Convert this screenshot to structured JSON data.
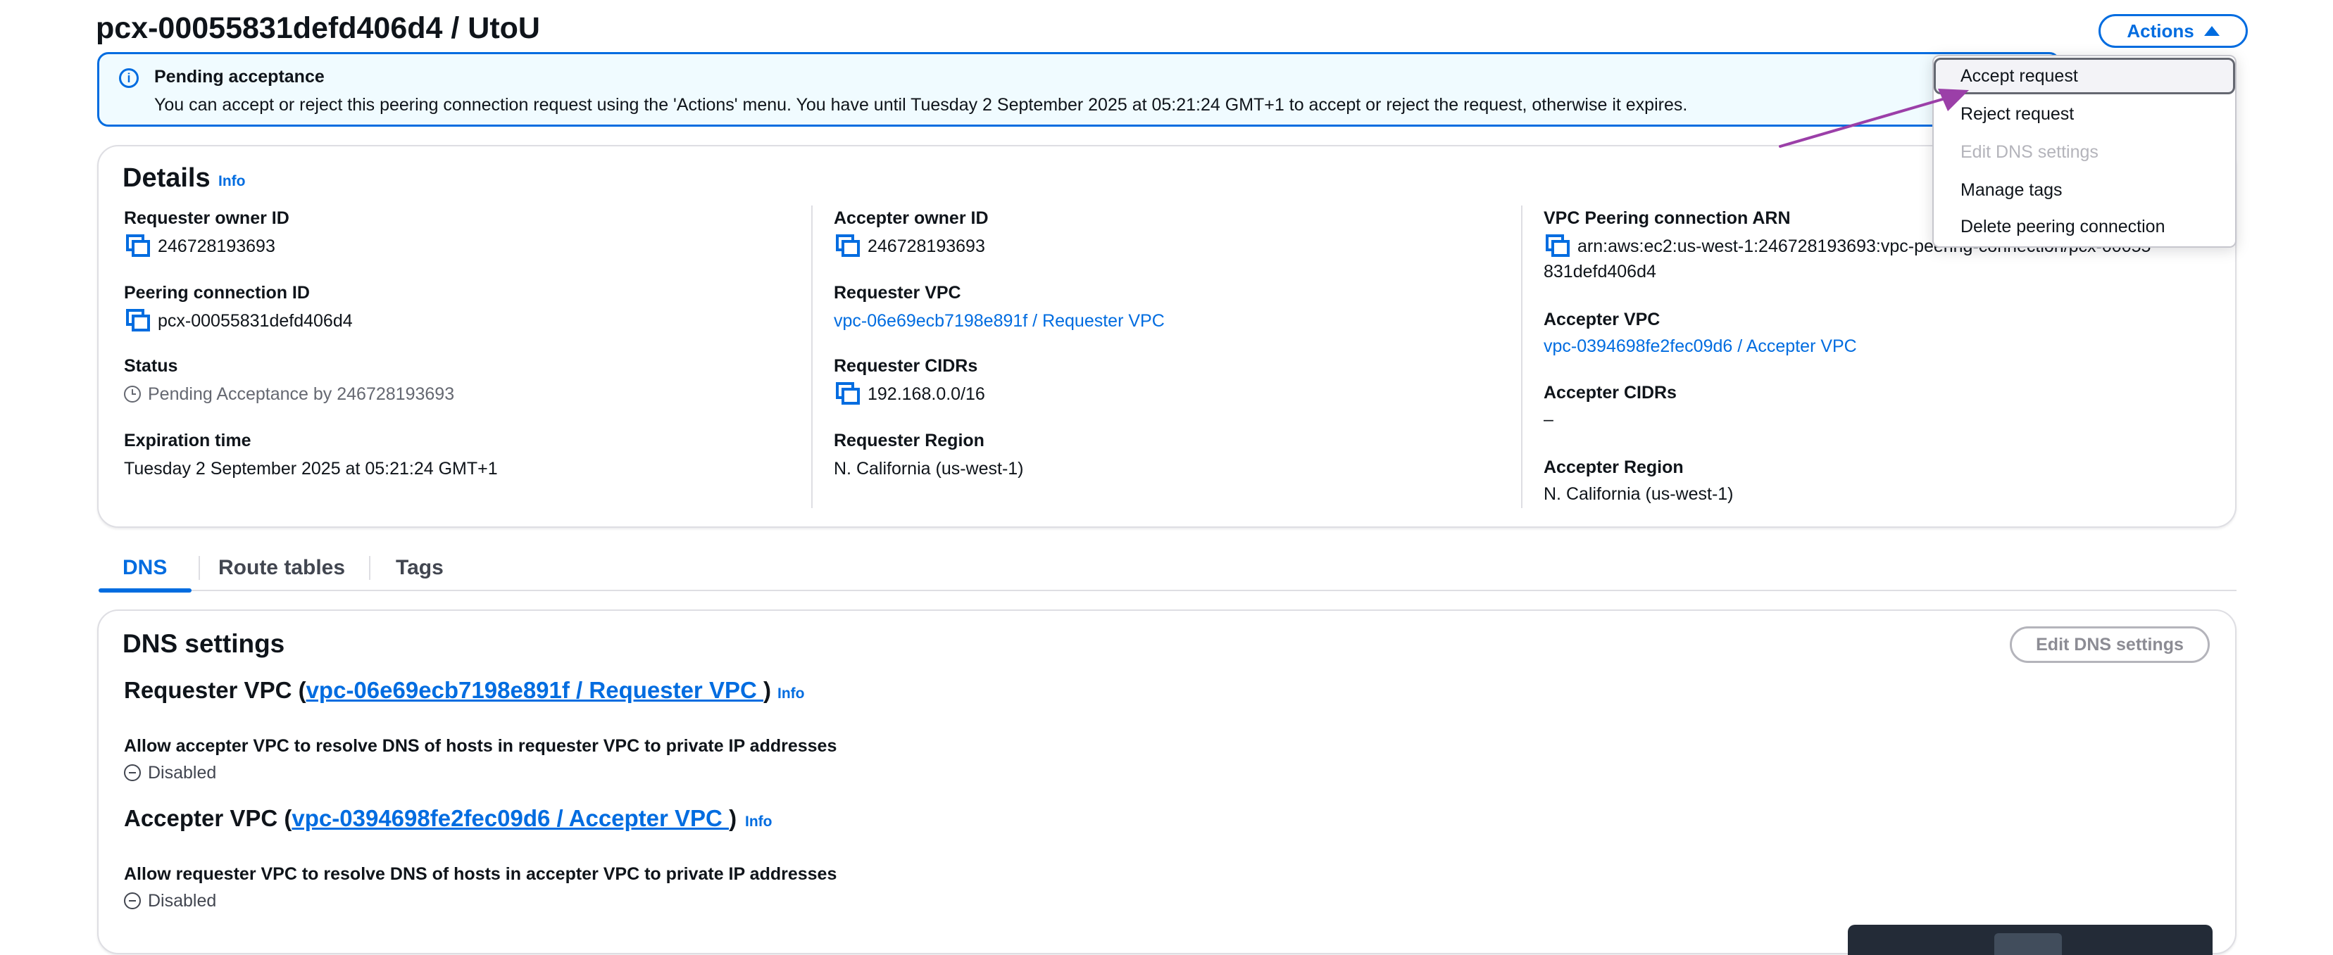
{
  "page": {
    "title": "pcx-00055831defd406d4 / UtoU",
    "actions_label": "Actions"
  },
  "alert": {
    "title": "Pending acceptance",
    "message": "You can accept or reject this peering connection request using the 'Actions' menu. You have until Tuesday 2 September 2025 at 05:21:24 GMT+1 to accept or reject the request, otherwise it expires."
  },
  "details": {
    "heading": "Details",
    "info": "Info",
    "col1": {
      "requester_owner_label": "Requester owner ID",
      "requester_owner_value": "246728193693",
      "peering_id_label": "Peering connection ID",
      "peering_id_value": "pcx-00055831defd406d4",
      "status_label": "Status",
      "status_value": "Pending Acceptance by 246728193693",
      "expiration_label": "Expiration time",
      "expiration_value": "Tuesday 2 September 2025 at 05:21:24 GMT+1"
    },
    "col2": {
      "accepter_owner_label": "Accepter owner ID",
      "accepter_owner_value": "246728193693",
      "requester_vpc_label": "Requester VPC",
      "requester_vpc_value": "vpc-06e69ecb7198e891f / Requester VPC",
      "requester_cidrs_label": "Requester CIDRs",
      "requester_cidrs_value": "192.168.0.0/16",
      "requester_region_label": "Requester Region",
      "requester_region_value": "N. California (us-west-1)"
    },
    "col3": {
      "arn_label": "VPC Peering connection ARN",
      "arn_line1": "arn:aws:ec2:us-west-1:246728193693:vpc-peering-connection/pcx-00055",
      "arn_line2": "831defd406d4",
      "accepter_vpc_label": "Accepter VPC",
      "accepter_vpc_value": "vpc-0394698fe2fec09d6 / Accepter VPC",
      "accepter_cidrs_label": "Accepter CIDRs",
      "accepter_cidrs_value": "–",
      "accepter_region_label": "Accepter Region",
      "accepter_region_value": "N. California (us-west-1)"
    }
  },
  "tabs": [
    {
      "label": "DNS"
    },
    {
      "label": "Route tables"
    },
    {
      "label": "Tags"
    }
  ],
  "dns": {
    "heading": "DNS settings",
    "edit_button": "Edit DNS settings",
    "requester": {
      "prefix": "Requester VPC (",
      "link": "vpc-06e69ecb7198e891f / Requester VPC ",
      "suffix": ")",
      "info": "Info",
      "setting_label": "Allow accepter VPC to resolve DNS of hosts in requester VPC to private IP addresses",
      "setting_value": "Disabled"
    },
    "accepter": {
      "prefix": "Accepter VPC (",
      "link": "vpc-0394698fe2fec09d6 / Accepter VPC ",
      "suffix": ")",
      "info": "Info",
      "setting_label": "Allow requester VPC to resolve DNS of hosts in accepter VPC to private IP addresses",
      "setting_value": "Disabled"
    }
  },
  "actions_menu": {
    "items": [
      {
        "label": "Accept request",
        "state": "highlighted"
      },
      {
        "label": "Reject request",
        "state": "enabled"
      },
      {
        "label": "Edit DNS settings",
        "state": "disabled"
      },
      {
        "label": "Manage tags",
        "state": "enabled"
      },
      {
        "label": "Delete peering connection",
        "state": "enabled"
      }
    ]
  },
  "colors": {
    "accent": "#006ce0",
    "alert_bg": "#f0fbff",
    "annotation_arrow": "#9b3fa8"
  }
}
